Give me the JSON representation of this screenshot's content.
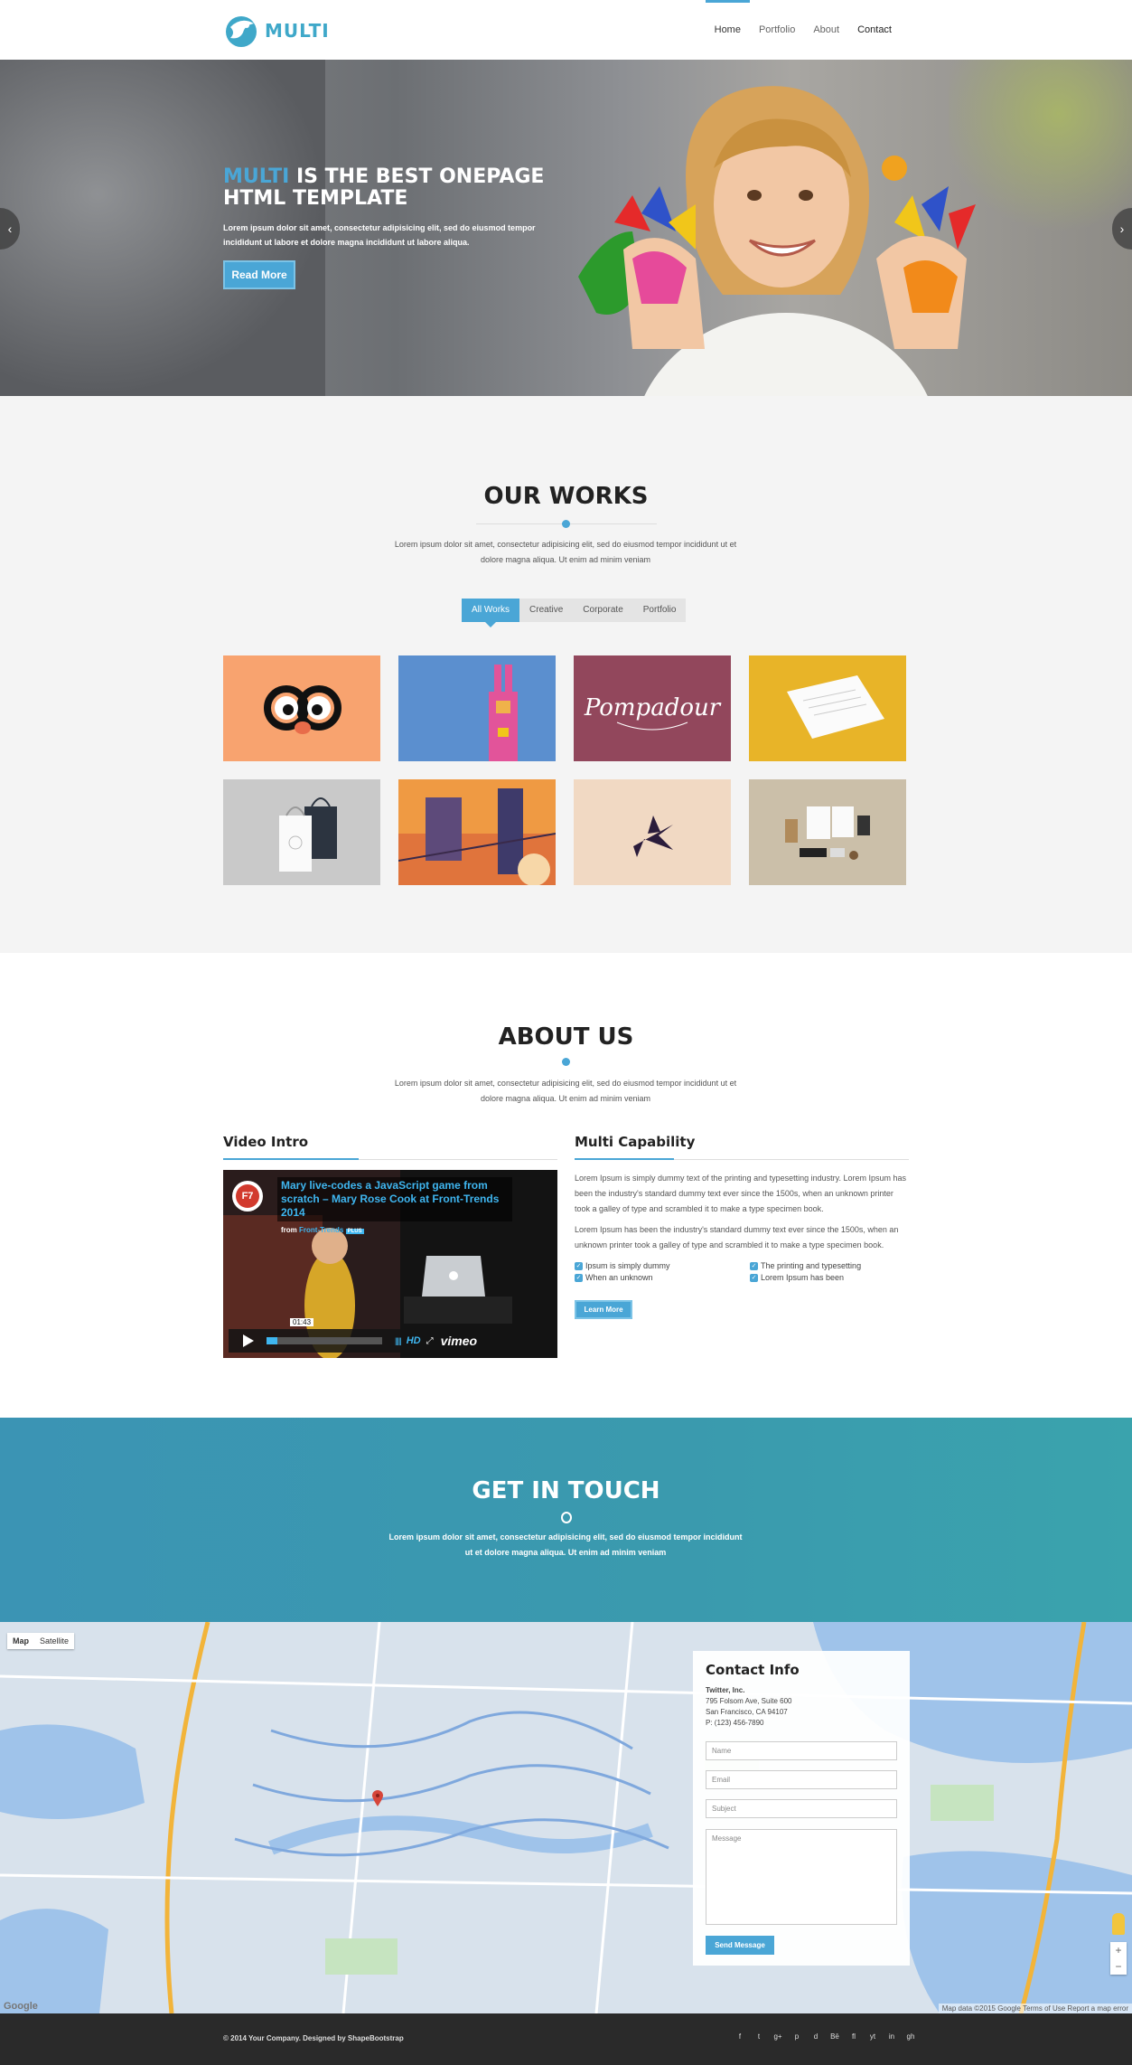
{
  "nav": {
    "brand": "MULTI",
    "items": [
      {
        "label": "Home",
        "active": true
      },
      {
        "label": "Portfolio",
        "active": false
      },
      {
        "label": "About",
        "active": false
      },
      {
        "label": "Contact",
        "active": false
      }
    ]
  },
  "hero": {
    "title_accent": "MULTI",
    "title_rest": " IS THE BEST ONEPAGE HTML TEMPLATE",
    "text": "Lorem ipsum dolor sit amet, consectetur adipisicing elit, sed do eiusmod tempor incididunt ut labore et dolore magna incididunt ut labore aliqua.",
    "button": "Read More",
    "prev_icon": "‹",
    "next_icon": "›"
  },
  "works": {
    "title": "OUR WORKS",
    "lead": "Lorem ipsum dolor sit amet, consectetur adipisicing elit, sed do eiusmod tempor incididunt ut et dolore magna aliqua. Ut enim ad minim veniam",
    "filters": [
      "All Works",
      "Creative",
      "Corporate",
      "Portfolio"
    ],
    "tile_colors": [
      "#f8a36f",
      "#5b8fcf",
      "#92475c",
      "#e8b428",
      "#c9c9c9",
      "#e8853e",
      "#f1d9c3",
      "#cbbfa9"
    ],
    "tile_3_text": "Pompadour"
  },
  "about": {
    "title": "ABOUT US",
    "lead": "Lorem ipsum dolor sit amet, consectetur adipisicing elit, sed do eiusmod tempor incididunt ut et dolore magna aliqua. Ut enim ad minim veniam",
    "video_title": "Video Intro",
    "video": {
      "heading": "Mary live-codes a JavaScript game from scratch – Mary Rose Cook at Front-Trends 2014",
      "from_label": "from",
      "channel": "Front-Trends",
      "badge": "PLUS",
      "time": "01:43",
      "hd": "HD",
      "provider": "vimeo",
      "logo_text": "F7"
    },
    "capability_title": "Multi Capability",
    "para1": "Lorem Ipsum is simply dummy text of the printing and typesetting industry. Lorem Ipsum has been the industry's standard dummy text ever since the 1500s, when an unknown printer took a galley of type and scrambled it to make a type specimen book.",
    "para2": "Lorem Ipsum has been the industry's standard dummy text ever since the 1500s, when an unknown printer took a galley of type and scrambled it to make a type specimen book.",
    "checks": [
      "Ipsum is simply dummy",
      "The printing and typesetting",
      "When an unknown",
      "Lorem Ipsum has been"
    ],
    "button": "Learn More"
  },
  "touch": {
    "title": "GET IN TOUCH",
    "lead": "Lorem ipsum dolor sit amet, consectetur adipisicing elit, sed do eiusmod tempor incididunt ut et dolore magna aliqua. Ut enim ad minim veniam"
  },
  "map": {
    "tabs": [
      "Map",
      "Satellite"
    ],
    "credit": "Map data ©2015 Google   Terms of Use   Report a map error",
    "google": "Google",
    "zoom_in": "+",
    "zoom_out": "−"
  },
  "contact": {
    "title": "Contact Info",
    "company": "Twitter, Inc.",
    "address1": "795 Folsom Ave, Suite 600",
    "address2": "San Francisco, CA 94107",
    "phone": "P: (123) 456-7890",
    "name_ph": "Name",
    "email_ph": "Email",
    "subject_ph": "Subject",
    "message_ph": "Message",
    "button": "Send Message"
  },
  "footer": {
    "copyright": "© 2014 Your Company. Designed by ShapeBootstrap",
    "social": [
      "f",
      "t",
      "g+",
      "p",
      "d",
      "Bē",
      "fl",
      "yt",
      "in",
      "gh"
    ]
  },
  "colors": {
    "accent": "#4aa6d6",
    "touch_bg": "#3a9aae",
    "footer_bg": "#2a2a2a"
  }
}
